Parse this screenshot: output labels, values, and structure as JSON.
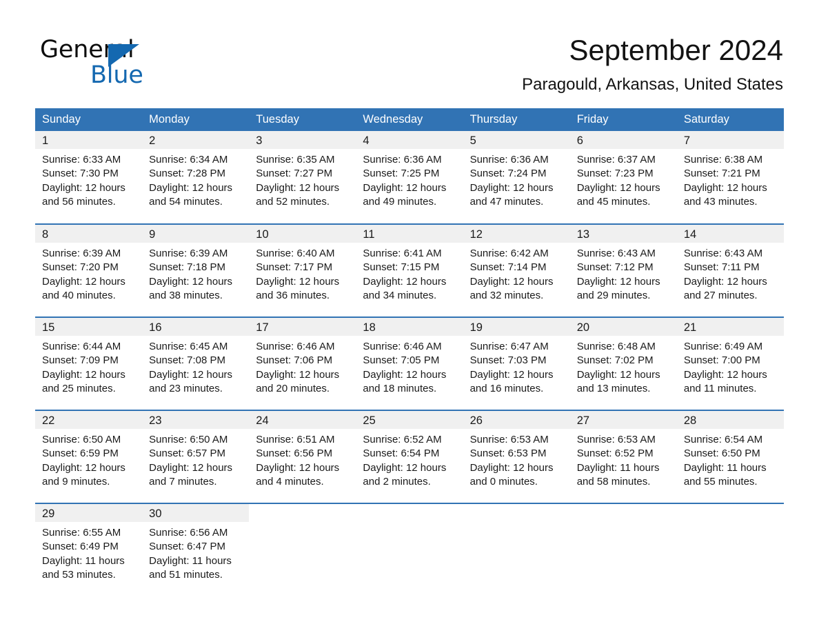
{
  "brand": {
    "name_part1": "General",
    "name_part2": "Blue",
    "accent_color": "#1468b0"
  },
  "header": {
    "month_title": "September 2024",
    "location": "Paragould, Arkansas, United States"
  },
  "theme": {
    "header_blue": "#3173b4",
    "daynum_band": "#f0f0f0",
    "text": "#1a1a1a"
  },
  "calendar": {
    "weekday_headers": [
      "Sunday",
      "Monday",
      "Tuesday",
      "Wednesday",
      "Thursday",
      "Friday",
      "Saturday"
    ],
    "weeks": [
      [
        {
          "day": "1",
          "sunrise": "Sunrise: 6:33 AM",
          "sunset": "Sunset: 7:30 PM",
          "daylight_line1": "Daylight: 12 hours",
          "daylight_line2": "and 56 minutes."
        },
        {
          "day": "2",
          "sunrise": "Sunrise: 6:34 AM",
          "sunset": "Sunset: 7:28 PM",
          "daylight_line1": "Daylight: 12 hours",
          "daylight_line2": "and 54 minutes."
        },
        {
          "day": "3",
          "sunrise": "Sunrise: 6:35 AM",
          "sunset": "Sunset: 7:27 PM",
          "daylight_line1": "Daylight: 12 hours",
          "daylight_line2": "and 52 minutes."
        },
        {
          "day": "4",
          "sunrise": "Sunrise: 6:36 AM",
          "sunset": "Sunset: 7:25 PM",
          "daylight_line1": "Daylight: 12 hours",
          "daylight_line2": "and 49 minutes."
        },
        {
          "day": "5",
          "sunrise": "Sunrise: 6:36 AM",
          "sunset": "Sunset: 7:24 PM",
          "daylight_line1": "Daylight: 12 hours",
          "daylight_line2": "and 47 minutes."
        },
        {
          "day": "6",
          "sunrise": "Sunrise: 6:37 AM",
          "sunset": "Sunset: 7:23 PM",
          "daylight_line1": "Daylight: 12 hours",
          "daylight_line2": "and 45 minutes."
        },
        {
          "day": "7",
          "sunrise": "Sunrise: 6:38 AM",
          "sunset": "Sunset: 7:21 PM",
          "daylight_line1": "Daylight: 12 hours",
          "daylight_line2": "and 43 minutes."
        }
      ],
      [
        {
          "day": "8",
          "sunrise": "Sunrise: 6:39 AM",
          "sunset": "Sunset: 7:20 PM",
          "daylight_line1": "Daylight: 12 hours",
          "daylight_line2": "and 40 minutes."
        },
        {
          "day": "9",
          "sunrise": "Sunrise: 6:39 AM",
          "sunset": "Sunset: 7:18 PM",
          "daylight_line1": "Daylight: 12 hours",
          "daylight_line2": "and 38 minutes."
        },
        {
          "day": "10",
          "sunrise": "Sunrise: 6:40 AM",
          "sunset": "Sunset: 7:17 PM",
          "daylight_line1": "Daylight: 12 hours",
          "daylight_line2": "and 36 minutes."
        },
        {
          "day": "11",
          "sunrise": "Sunrise: 6:41 AM",
          "sunset": "Sunset: 7:15 PM",
          "daylight_line1": "Daylight: 12 hours",
          "daylight_line2": "and 34 minutes."
        },
        {
          "day": "12",
          "sunrise": "Sunrise: 6:42 AM",
          "sunset": "Sunset: 7:14 PM",
          "daylight_line1": "Daylight: 12 hours",
          "daylight_line2": "and 32 minutes."
        },
        {
          "day": "13",
          "sunrise": "Sunrise: 6:43 AM",
          "sunset": "Sunset: 7:12 PM",
          "daylight_line1": "Daylight: 12 hours",
          "daylight_line2": "and 29 minutes."
        },
        {
          "day": "14",
          "sunrise": "Sunrise: 6:43 AM",
          "sunset": "Sunset: 7:11 PM",
          "daylight_line1": "Daylight: 12 hours",
          "daylight_line2": "and 27 minutes."
        }
      ],
      [
        {
          "day": "15",
          "sunrise": "Sunrise: 6:44 AM",
          "sunset": "Sunset: 7:09 PM",
          "daylight_line1": "Daylight: 12 hours",
          "daylight_line2": "and 25 minutes."
        },
        {
          "day": "16",
          "sunrise": "Sunrise: 6:45 AM",
          "sunset": "Sunset: 7:08 PM",
          "daylight_line1": "Daylight: 12 hours",
          "daylight_line2": "and 23 minutes."
        },
        {
          "day": "17",
          "sunrise": "Sunrise: 6:46 AM",
          "sunset": "Sunset: 7:06 PM",
          "daylight_line1": "Daylight: 12 hours",
          "daylight_line2": "and 20 minutes."
        },
        {
          "day": "18",
          "sunrise": "Sunrise: 6:46 AM",
          "sunset": "Sunset: 7:05 PM",
          "daylight_line1": "Daylight: 12 hours",
          "daylight_line2": "and 18 minutes."
        },
        {
          "day": "19",
          "sunrise": "Sunrise: 6:47 AM",
          "sunset": "Sunset: 7:03 PM",
          "daylight_line1": "Daylight: 12 hours",
          "daylight_line2": "and 16 minutes."
        },
        {
          "day": "20",
          "sunrise": "Sunrise: 6:48 AM",
          "sunset": "Sunset: 7:02 PM",
          "daylight_line1": "Daylight: 12 hours",
          "daylight_line2": "and 13 minutes."
        },
        {
          "day": "21",
          "sunrise": "Sunrise: 6:49 AM",
          "sunset": "Sunset: 7:00 PM",
          "daylight_line1": "Daylight: 12 hours",
          "daylight_line2": "and 11 minutes."
        }
      ],
      [
        {
          "day": "22",
          "sunrise": "Sunrise: 6:50 AM",
          "sunset": "Sunset: 6:59 PM",
          "daylight_line1": "Daylight: 12 hours",
          "daylight_line2": "and 9 minutes."
        },
        {
          "day": "23",
          "sunrise": "Sunrise: 6:50 AM",
          "sunset": "Sunset: 6:57 PM",
          "daylight_line1": "Daylight: 12 hours",
          "daylight_line2": "and 7 minutes."
        },
        {
          "day": "24",
          "sunrise": "Sunrise: 6:51 AM",
          "sunset": "Sunset: 6:56 PM",
          "daylight_line1": "Daylight: 12 hours",
          "daylight_line2": "and 4 minutes."
        },
        {
          "day": "25",
          "sunrise": "Sunrise: 6:52 AM",
          "sunset": "Sunset: 6:54 PM",
          "daylight_line1": "Daylight: 12 hours",
          "daylight_line2": "and 2 minutes."
        },
        {
          "day": "26",
          "sunrise": "Sunrise: 6:53 AM",
          "sunset": "Sunset: 6:53 PM",
          "daylight_line1": "Daylight: 12 hours",
          "daylight_line2": "and 0 minutes."
        },
        {
          "day": "27",
          "sunrise": "Sunrise: 6:53 AM",
          "sunset": "Sunset: 6:52 PM",
          "daylight_line1": "Daylight: 11 hours",
          "daylight_line2": "and 58 minutes."
        },
        {
          "day": "28",
          "sunrise": "Sunrise: 6:54 AM",
          "sunset": "Sunset: 6:50 PM",
          "daylight_line1": "Daylight: 11 hours",
          "daylight_line2": "and 55 minutes."
        }
      ],
      [
        {
          "day": "29",
          "sunrise": "Sunrise: 6:55 AM",
          "sunset": "Sunset: 6:49 PM",
          "daylight_line1": "Daylight: 11 hours",
          "daylight_line2": "and 53 minutes."
        },
        {
          "day": "30",
          "sunrise": "Sunrise: 6:56 AM",
          "sunset": "Sunset: 6:47 PM",
          "daylight_line1": "Daylight: 11 hours",
          "daylight_line2": "and 51 minutes."
        },
        {
          "day": "",
          "sunrise": "",
          "sunset": "",
          "daylight_line1": "",
          "daylight_line2": "",
          "blank": true
        },
        {
          "day": "",
          "sunrise": "",
          "sunset": "",
          "daylight_line1": "",
          "daylight_line2": "",
          "blank": true
        },
        {
          "day": "",
          "sunrise": "",
          "sunset": "",
          "daylight_line1": "",
          "daylight_line2": "",
          "blank": true
        },
        {
          "day": "",
          "sunrise": "",
          "sunset": "",
          "daylight_line1": "",
          "daylight_line2": "",
          "blank": true
        },
        {
          "day": "",
          "sunrise": "",
          "sunset": "",
          "daylight_line1": "",
          "daylight_line2": "",
          "blank": true
        }
      ]
    ]
  }
}
